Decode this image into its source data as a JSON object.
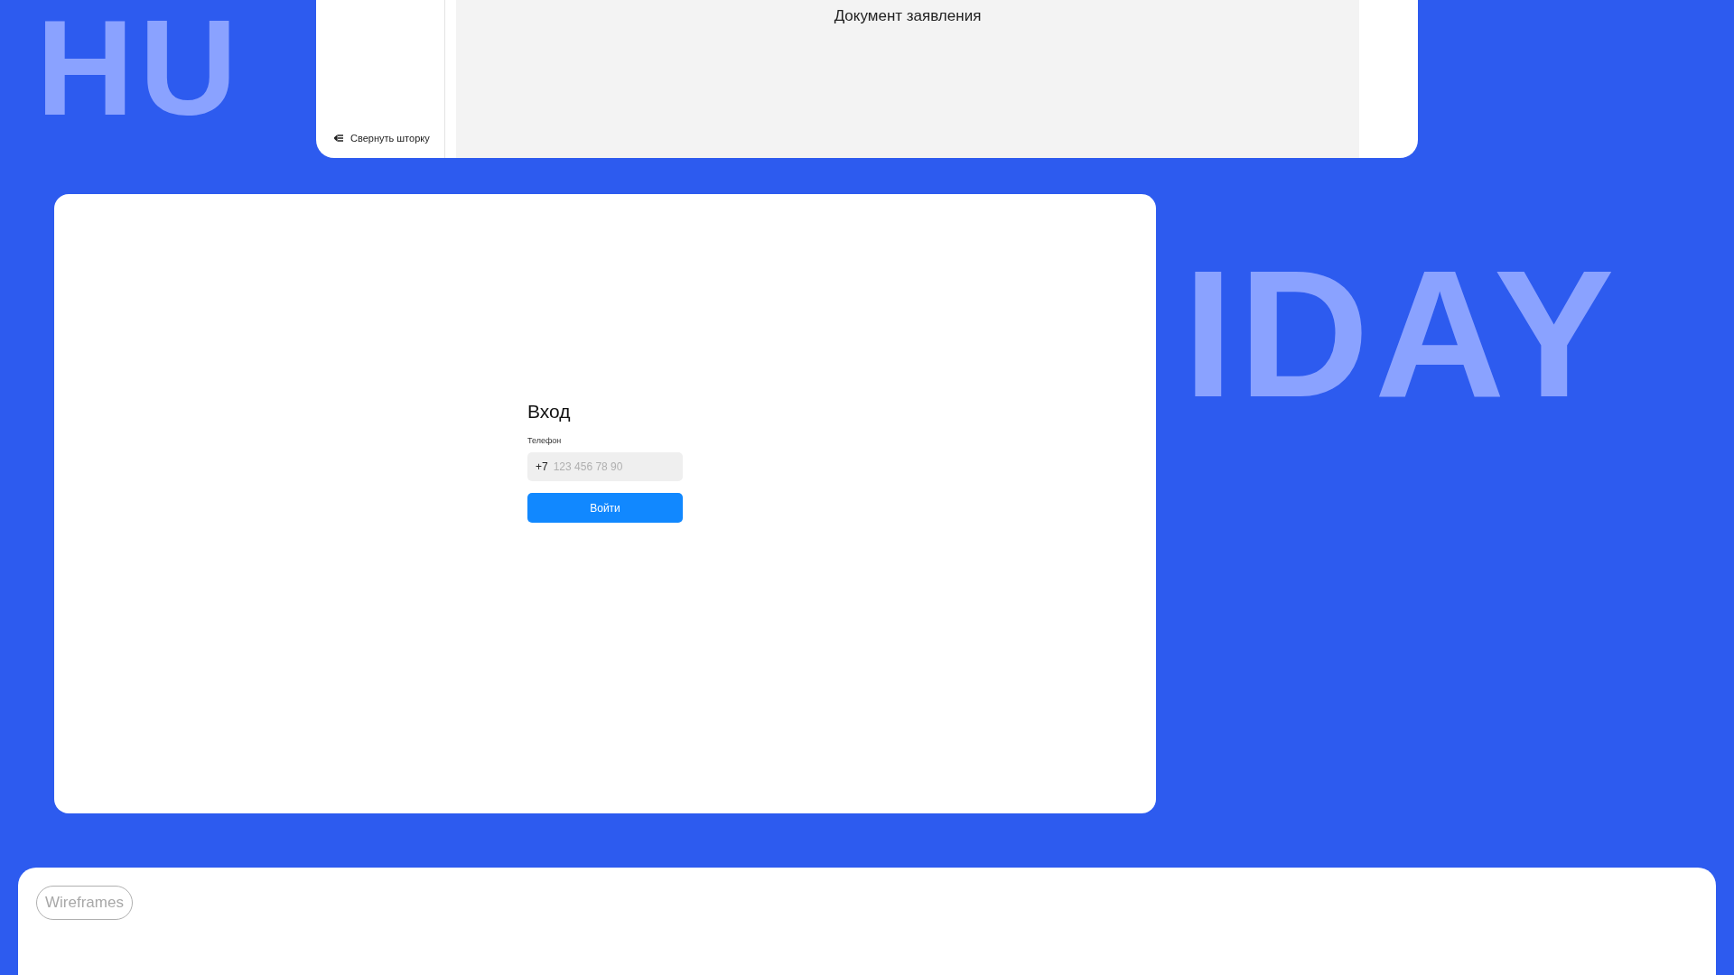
{
  "backdrop": {
    "top_word": "HU",
    "right_word": "IDAY"
  },
  "document_screen": {
    "sidebar": {
      "collapse_label": "Свернуть шторку"
    },
    "document_title": "Документ заявления"
  },
  "login_screen": {
    "title": "Вход",
    "phone": {
      "label": "Телефон",
      "prefix": "+7",
      "placeholder": "123 456 78 90"
    },
    "submit": "Войти"
  },
  "section": {
    "tag": "Wireframes"
  }
}
